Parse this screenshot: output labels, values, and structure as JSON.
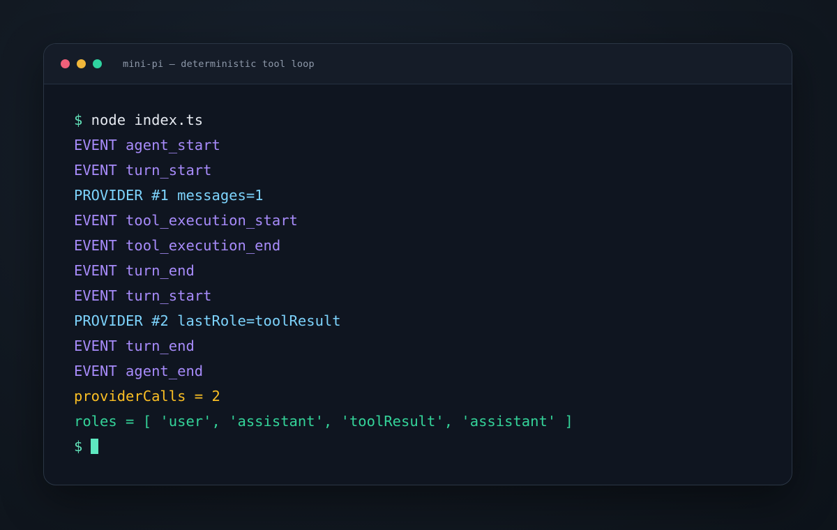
{
  "window": {
    "title": "mini-pi — deterministic tool loop"
  },
  "terminal": {
    "prompt": "$",
    "command_line": "$ node index.ts",
    "lines": [
      {
        "kind": "event",
        "text": "EVENT agent_start"
      },
      {
        "kind": "event",
        "text": "EVENT turn_start"
      },
      {
        "kind": "provider",
        "text": "PROVIDER #1 messages=1"
      },
      {
        "kind": "event",
        "text": "EVENT tool_execution_start"
      },
      {
        "kind": "event",
        "text": "EVENT tool_execution_end"
      },
      {
        "kind": "event",
        "text": "EVENT turn_end"
      },
      {
        "kind": "event",
        "text": "EVENT turn_start"
      },
      {
        "kind": "provider",
        "text": "PROVIDER #2 lastRole=toolResult"
      },
      {
        "kind": "event",
        "text": "EVENT turn_end"
      },
      {
        "kind": "event",
        "text": "EVENT agent_end"
      },
      {
        "kind": "count",
        "text": "providerCalls = 2"
      },
      {
        "kind": "roles",
        "text": "roles = [ 'user', 'assistant', 'toolResult', 'assistant' ]"
      }
    ]
  },
  "colors": {
    "close_dot": "#f0607a",
    "minimize_dot": "#f1b73a",
    "maximize_dot": "#2fd3a0",
    "prompt": "#61e0b8",
    "event": "#a78bfa",
    "provider": "#7dd3fc",
    "count": "#fbbf24",
    "roles": "#34d399",
    "cursor": "#5ee8c0"
  }
}
